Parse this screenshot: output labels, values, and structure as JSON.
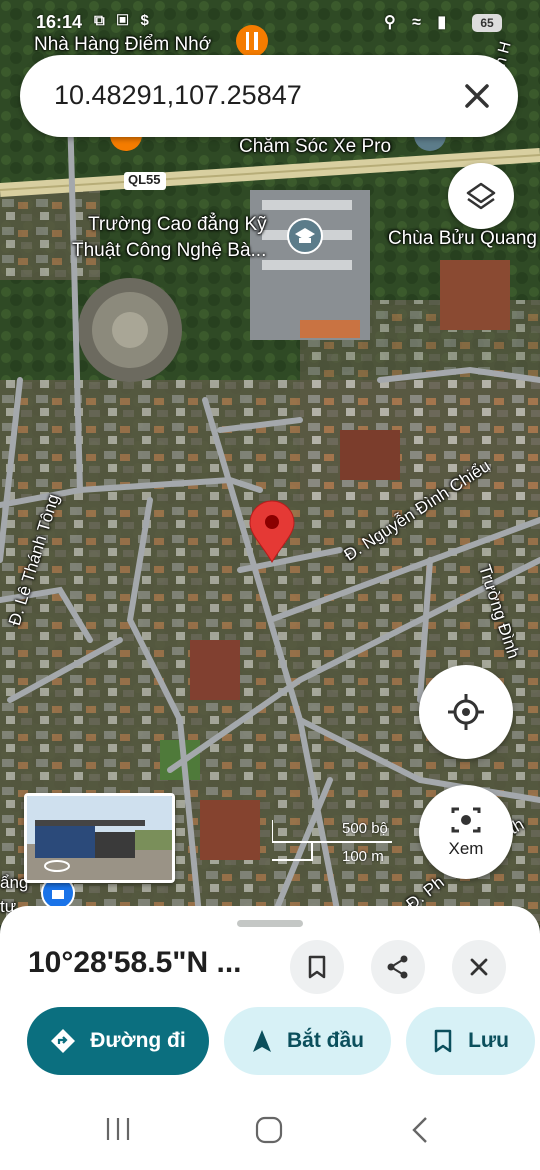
{
  "status_bar": {
    "time": "16:14",
    "notification_icons": "⧉ ▣ $",
    "right_icons": "⚲ ≈ ▮",
    "battery": "65"
  },
  "search": {
    "query": "10.48291,107.25847"
  },
  "map": {
    "labels": [
      "Nhà Hàng Điểm Nhớ",
      "Chăm Sóc Xe Pro",
      "QL55",
      "Trường Cao đẳng Kỹ",
      "Thuật Công Nghệ Bà...",
      "Chùa Bửu Quang",
      "Đ. Nguyễn Đình Chiểu",
      "Đ. Lê Thánh Tông",
      "Trường Đình",
      "Đ. Ph",
      "Đê th",
      "ẩng",
      "tư",
      "ăm Văn H"
    ],
    "scale": {
      "feet": "500 bộ",
      "meters": "100 m"
    },
    "xem_label": "Xem"
  },
  "sheet": {
    "coordinates": "10°28'58.5\"N ...",
    "buttons": {
      "directions": "Đường đi",
      "start": "Bắt đầu",
      "save": "Lưu"
    }
  },
  "colors": {
    "accent": "#0b6f7f",
    "tonal": "#d7f1f6",
    "pin": "#e53935"
  }
}
